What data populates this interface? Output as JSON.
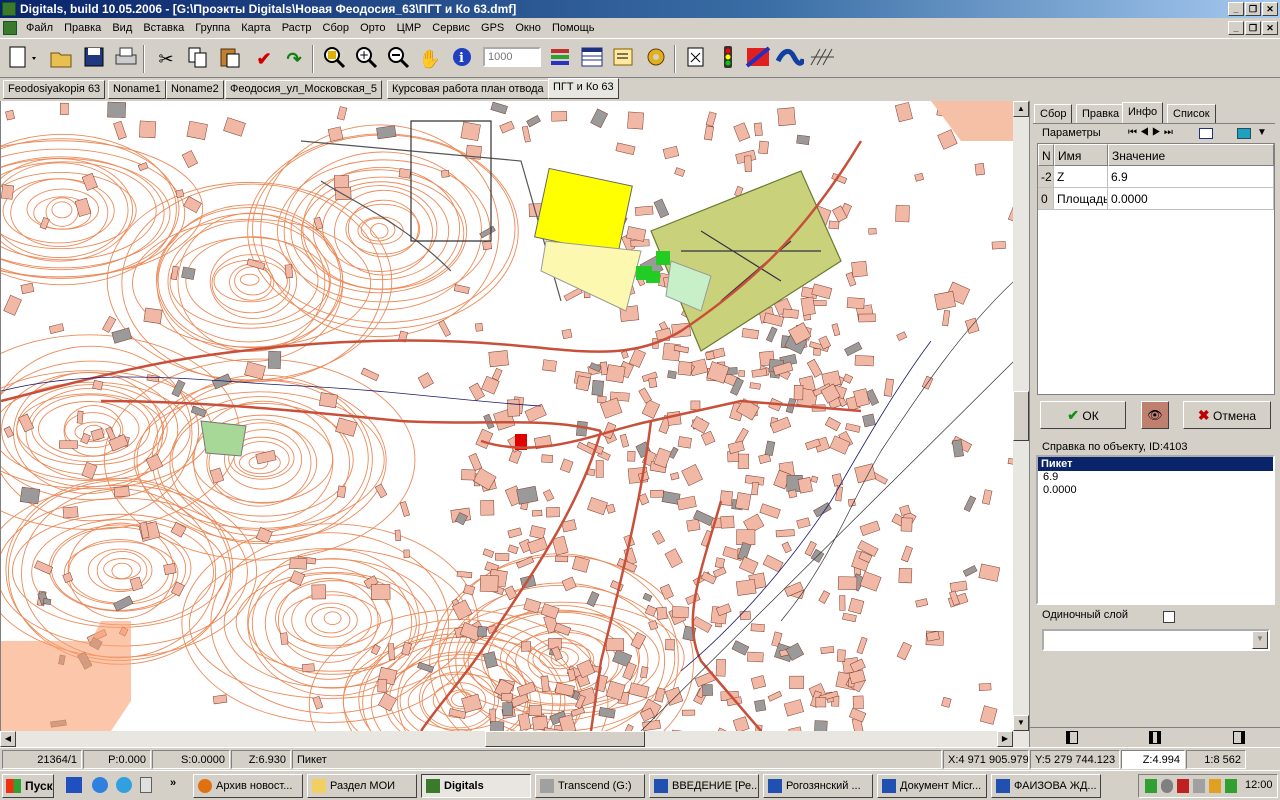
{
  "window": {
    "title": "Digitals, build 10.05.2006 - [G:\\Проэкты Digitals\\Новая Феодосия_63\\ПГТ и Ко 63.dmf]"
  },
  "menu": [
    "Файл",
    "Правка",
    "Вид",
    "Вставка",
    "Группа",
    "Карта",
    "Растр",
    "Сбор",
    "Орто",
    "ЦМР",
    "Сервис",
    "GPS",
    "Окно",
    "Помощь"
  ],
  "toolbar": {
    "scale_placeholder": "1000"
  },
  "doc_tabs": [
    "Feodosiyakopiя 63",
    "Noname1",
    "Noname2",
    "Феодосия_ул_Московская_5",
    "Курсовая работа план отвода",
    "ПГТ и Ко 63"
  ],
  "doc_tabs_active": 5,
  "right_panel": {
    "tabs": [
      "Сбор",
      "Правка",
      "Инфо",
      "Список"
    ],
    "active_tab": 2,
    "params_label": "Параметры",
    "grid_headers": [
      "N",
      "Имя",
      "Значение"
    ],
    "grid_rows": [
      {
        "n": "-2",
        "name": "Z",
        "value": "6.9"
      },
      {
        "n": "0",
        "name": "Площадь",
        "value": "0.0000"
      }
    ],
    "ok_label": "ОК",
    "cancel_label": "Отмена",
    "object_info_label": "Справка по объекту, ID:4103",
    "object_info_items": [
      "Пикет",
      "6.9",
      "0.0000"
    ],
    "single_layer_label": "Одиночный слой"
  },
  "status": {
    "count": "21364/1",
    "perimeter": "P:0.000",
    "area": "S:0.0000",
    "z": "Z:6.930",
    "object_type": "Пикет",
    "x_coord": "X:4 971 905.979",
    "y_coord": "Y:5 279 744.123",
    "z_input": "Z:4.994",
    "scale": "1:8 562"
  },
  "taskbar": {
    "start_label": "Пуск",
    "tasks": [
      "Архив новост...",
      "Раздел МОИ",
      "Digitals",
      "Transcend (G:)",
      "ВВЕДЕНИЕ [Ре...",
      "Рогозянский ...",
      "Документ Micr...",
      "ФАИЗОВА ЖД..."
    ],
    "active_task": 2,
    "clock": "12:00"
  },
  "colors": {
    "title_gradient_start": "#0a246a",
    "title_gradient_end": "#a6caf0",
    "map_building": "#f2b8a6",
    "map_contour": "#e8763c",
    "map_road": "#c8503a",
    "map_park": "#c9d27a",
    "map_yellow_lot": "#ffff00",
    "map_green_lot": "#22cc22"
  }
}
